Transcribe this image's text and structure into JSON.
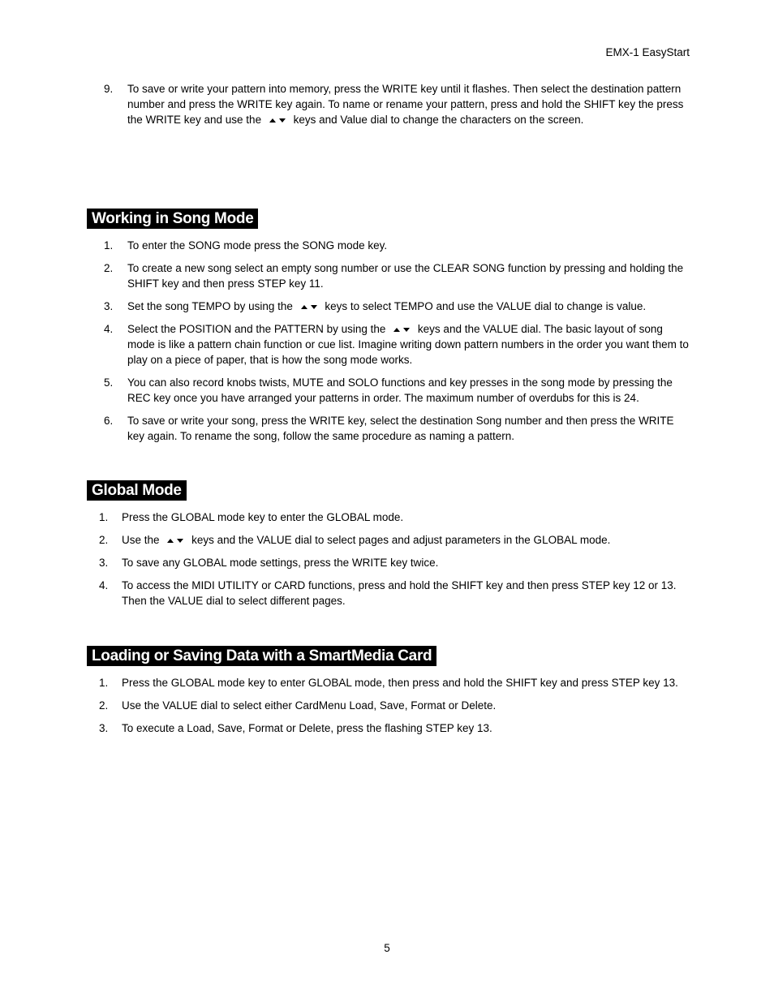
{
  "header": {
    "doc_title": "EMX-1 EasyStart"
  },
  "intro_item": {
    "number": "9.",
    "text_before": "To save or write your pattern into memory, press the WRITE key until it flashes. Then select the destination pattern number and press the WRITE key again. To name or rename your pattern, press and hold the SHIFT key the press the WRITE key and use the",
    "text_after": "keys and Value dial to change the characters on the screen."
  },
  "icons": {
    "up": "up-triangle-icon",
    "down": "down-triangle-icon"
  },
  "sections": [
    {
      "title": "Working in Song Mode",
      "items": [
        {
          "number": "1.",
          "text": "To enter the SONG mode press the SONG mode key."
        },
        {
          "number": "2.",
          "text": "To create a new song select an empty song number or use the CLEAR SONG function by pressing and holding the SHIFT key and then press STEP key 11."
        },
        {
          "number": "3.",
          "text_before": "Set the song TEMPO by using the",
          "text_after": "keys to select TEMPO and use the VALUE dial to change is value."
        },
        {
          "number": "4.",
          "text_before": "Select the POSITION and the PATTERN by using the",
          "text_after": "keys and the VALUE dial. The basic layout of song mode is like a pattern chain function or cue list. Imagine writing down pattern numbers in the order you want them to play on a piece of paper, that is how the song mode works."
        },
        {
          "number": "5.",
          "text": "You can also record knobs twists, MUTE and SOLO functions and key presses in the song mode by pressing the REC key once you have arranged your patterns in order. The maximum number of overdubs for this is 24."
        },
        {
          "number": "6.",
          "text": "To save or write your song, press the WRITE key, select the destination Song number and then press the WRITE key again. To rename the song, follow the same procedure as naming a pattern."
        }
      ]
    },
    {
      "title": "Global Mode",
      "items": [
        {
          "number": "1.",
          "text": "Press the GLOBAL mode key to enter the GLOBAL mode."
        },
        {
          "number": "2.",
          "text_before": "Use the",
          "text_after": "keys and the VALUE dial to select pages and adjust parameters in the GLOBAL mode."
        },
        {
          "number": "3.",
          "text": "To save any GLOBAL mode settings, press the WRITE key twice."
        },
        {
          "number": "4.",
          "text": "To access the MIDI UTILITY or CARD functions, press and hold the SHIFT key and then press STEP key 12 or 13. Then the VALUE dial to select different pages."
        }
      ]
    },
    {
      "title": "Loading or Saving Data with a SmartMedia Card",
      "items": [
        {
          "number": "1.",
          "text": "Press the GLOBAL mode key to enter GLOBAL mode, then press and hold the SHIFT key and press STEP key 13."
        },
        {
          "number": "2.",
          "text": "Use the VALUE dial to select either CardMenu Load, Save, Format or Delete."
        },
        {
          "number": "3.",
          "text": "To execute a Load, Save, Format or Delete, press the flashing STEP key 13."
        }
      ]
    }
  ],
  "footer": {
    "page_number": "5"
  }
}
